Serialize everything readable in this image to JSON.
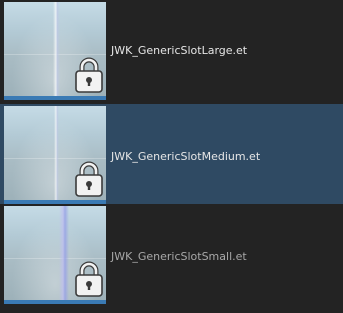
{
  "asset_list": {
    "items": [
      {
        "label": "JWK_GenericSlotLarge.et",
        "locked": true,
        "selected": false,
        "lock_icon": "padlock-icon"
      },
      {
        "label": "JWK_GenericSlotMedium.et",
        "locked": true,
        "selected": true,
        "lock_icon": "padlock-icon"
      },
      {
        "label": "JWK_GenericSlotSmall.et",
        "locked": true,
        "selected": false,
        "lock_icon": "padlock-icon"
      }
    ]
  },
  "colors": {
    "background": "#232323",
    "selected_row": "#2f4a63",
    "thumbnail_bar": "#3a7ab4",
    "label_text": "#e6e6e6"
  }
}
